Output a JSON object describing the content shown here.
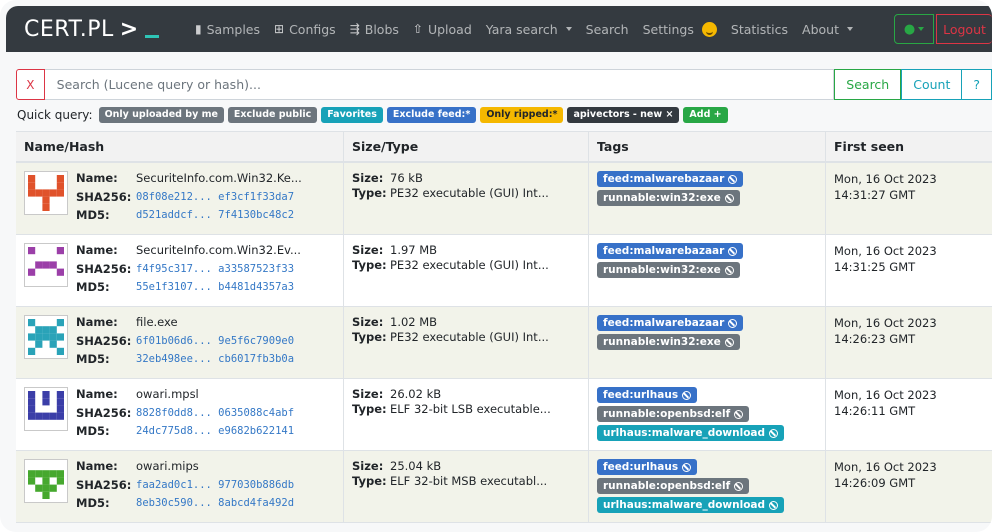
{
  "brand": {
    "text": "CERT.PL",
    "prompt": ">"
  },
  "nav": {
    "items": [
      {
        "label": "Samples",
        "icon": "file-icon",
        "glyph": "▮"
      },
      {
        "label": "Configs",
        "icon": "table-icon",
        "glyph": "⊞"
      },
      {
        "label": "Blobs",
        "icon": "scroll-icon",
        "glyph": "⇶"
      },
      {
        "label": "Upload",
        "icon": "upload-icon",
        "glyph": "⇧"
      },
      {
        "label": "Yara search",
        "dropdown": true
      },
      {
        "label": "Search"
      },
      {
        "label": "Settings",
        "badge": "smiley"
      },
      {
        "label": "Statistics"
      },
      {
        "label": "About",
        "dropdown": true
      }
    ],
    "logout": "Logout"
  },
  "search": {
    "clear": "X",
    "placeholder": "Search (Lucene query or hash)...",
    "search_btn": "Search",
    "count_btn": "Count",
    "help_btn": "?"
  },
  "quick_query": {
    "label": "Quick query:",
    "badges": [
      {
        "text": "Only uploaded by me",
        "color": "#6c757d"
      },
      {
        "text": "Exclude public",
        "color": "#6c757d"
      },
      {
        "text": "Favorites",
        "color": "#17a2b8"
      },
      {
        "text": "Exclude feed:*",
        "color": "#3771c8"
      },
      {
        "text": "Only ripped:*",
        "color": "#f5b800",
        "dark": true
      },
      {
        "text": "apivectors - new ×",
        "color": "#343a40"
      },
      {
        "text": "Add +",
        "color": "#28a745"
      }
    ]
  },
  "table": {
    "headers": [
      "Name/Hash",
      "Size/Type",
      "Tags",
      "First seen"
    ],
    "labels": {
      "name": "Name:",
      "sha256": "SHA256:",
      "md5": "MD5:",
      "size": "Size:",
      "type": "Type:"
    },
    "rows": [
      {
        "name": "SecuriteInfo.com.Win32.Ke...",
        "sha256": "08f08e212... ef3cf1f33da7",
        "md5": "d521addcf... 7f4130bc48c2",
        "size": "76 kB",
        "type": "PE32 executable (GUI) Int...",
        "tags": [
          {
            "text": "feed:malwarebazaar",
            "color": "#3771c8"
          },
          {
            "text": "runnable:win32:exe",
            "color": "#6c757d"
          }
        ],
        "date": "Mon, 16 Oct 2023",
        "time": "14:31:27 GMT",
        "icon_color": "#e0522b"
      },
      {
        "name": "SecuriteInfo.com.Win32.Ev...",
        "sha256": "f4f95c317... a33587523f33",
        "md5": "55e1f3107... b4481d4357a3",
        "size": "1.97 MB",
        "type": "PE32 executable (GUI) Int...",
        "tags": [
          {
            "text": "feed:malwarebazaar",
            "color": "#3771c8"
          },
          {
            "text": "runnable:win32:exe",
            "color": "#6c757d"
          }
        ],
        "date": "Mon, 16 Oct 2023",
        "time": "14:31:25 GMT",
        "icon_color": "#9b3fa8"
      },
      {
        "name": "file.exe",
        "sha256": "6f01b06d6... 9e5f6c7909e0",
        "md5": "32eb498ee... cb6017fb3b0a",
        "size": "1.02 MB",
        "type": "PE32 executable (GUI) Int...",
        "tags": [
          {
            "text": "feed:malwarebazaar",
            "color": "#3771c8"
          },
          {
            "text": "runnable:win32:exe",
            "color": "#6c757d"
          }
        ],
        "date": "Mon, 16 Oct 2023",
        "time": "14:26:23 GMT",
        "icon_color": "#2aa3b8"
      },
      {
        "name": "owari.mpsl",
        "sha256": "8828f0dd8... 0635088c4abf",
        "md5": "24dc775d8... e9682b622141",
        "size": "26.02 kB",
        "type": "ELF 32-bit LSB executable...",
        "tags": [
          {
            "text": "feed:urlhaus",
            "color": "#3771c8"
          },
          {
            "text": "runnable:openbsd:elf",
            "color": "#6c757d"
          },
          {
            "text": "urlhaus:malware_download",
            "color": "#17a2b8"
          }
        ],
        "date": "Mon, 16 Oct 2023",
        "time": "14:26:11 GMT",
        "icon_color": "#3b3ea8"
      },
      {
        "name": "owari.mips",
        "sha256": "faa2ad0c1... 977030b886db",
        "md5": "8eb30c590... 8abcd4fa492d",
        "size": "25.04 kB",
        "type": "ELF 32-bit MSB executabl...",
        "tags": [
          {
            "text": "feed:urlhaus",
            "color": "#3771c8"
          },
          {
            "text": "runnable:openbsd:elf",
            "color": "#6c757d"
          },
          {
            "text": "urlhaus:malware_download",
            "color": "#17a2b8"
          }
        ],
        "date": "Mon, 16 Oct 2023",
        "time": "14:26:09 GMT",
        "icon_color": "#46a82e"
      }
    ]
  }
}
